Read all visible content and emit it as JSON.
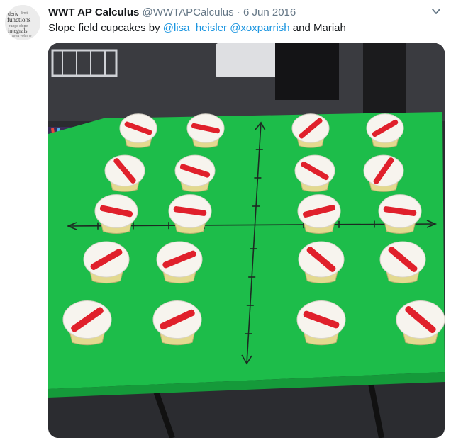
{
  "tweet": {
    "author_name": "WWT AP Calculus",
    "handle": "@WWTAPCalculus",
    "separator": "·",
    "date": "6 Jun 2016",
    "text_before": "Slope field cupcakes by ",
    "mention_1": "@lisa_heisler",
    "mention_2": "@xoxparrish",
    "text_after": " and Mariah",
    "avatar_icon": "word-cloud-avatar",
    "menu_icon": "chevron-down-icon"
  },
  "photo": {
    "subject": "slope-field-cupcakes-photo",
    "colors": {
      "poster": "#1dbd4a",
      "frosting": "#f7f4ee",
      "sprinkles": "#e0202b",
      "cake": "#e3d98f",
      "table": "#2a2a2a"
    },
    "cupcake_stripe_angles": [
      [
        20,
        12,
        -40,
        -30
      ],
      [
        50,
        18,
        30,
        -55
      ],
      [
        12,
        8,
        -14,
        8
      ],
      [
        -30,
        -22,
        40,
        40
      ],
      [
        -35,
        -25,
        20,
        40
      ]
    ]
  }
}
